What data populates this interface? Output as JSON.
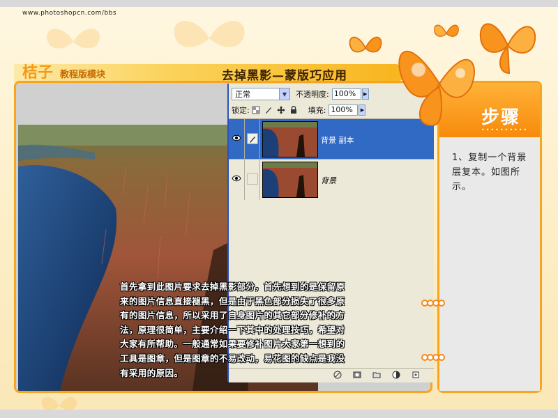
{
  "site": {
    "url": "www.photoshopcn.com/bbs"
  },
  "header": {
    "brand": "桔子",
    "brand_sub": "教程版模块",
    "title": "去掉黑影—蒙版巧应用"
  },
  "layers_panel": {
    "blend_mode": "正常",
    "opacity_label": "不透明度:",
    "opacity_value": "100%",
    "lock_label": "锁定:",
    "fill_label": "填充:",
    "fill_value": "100%",
    "layers": [
      {
        "name": "背景 副本",
        "selected": true
      },
      {
        "name": "背景",
        "selected": false
      }
    ]
  },
  "description": "首先拿到此图片要求去掉黑影部分，首先想到的是保留原\n来的图片信息直接褪黑，但是由于黑色部分损失了很多原\n有的图片信息，所以采用了自身图片的其它部分修补的方\n法，原理很简单，主要介绍一下其中的处理技巧，希望对\n大家有所帮助。一般通常如果要修补图片大家第一想到的\n工具是图章，但是图章的不易改动，易花图的缺点是我没\n有采用的原因。",
  "steps": {
    "title": "步骤",
    "dots": "••••••••••",
    "text": "1、复制一个背景\n层复本。如图所\n示。"
  },
  "colors": {
    "accent": "#f7a51e",
    "selected_layer": "#316ac5"
  }
}
